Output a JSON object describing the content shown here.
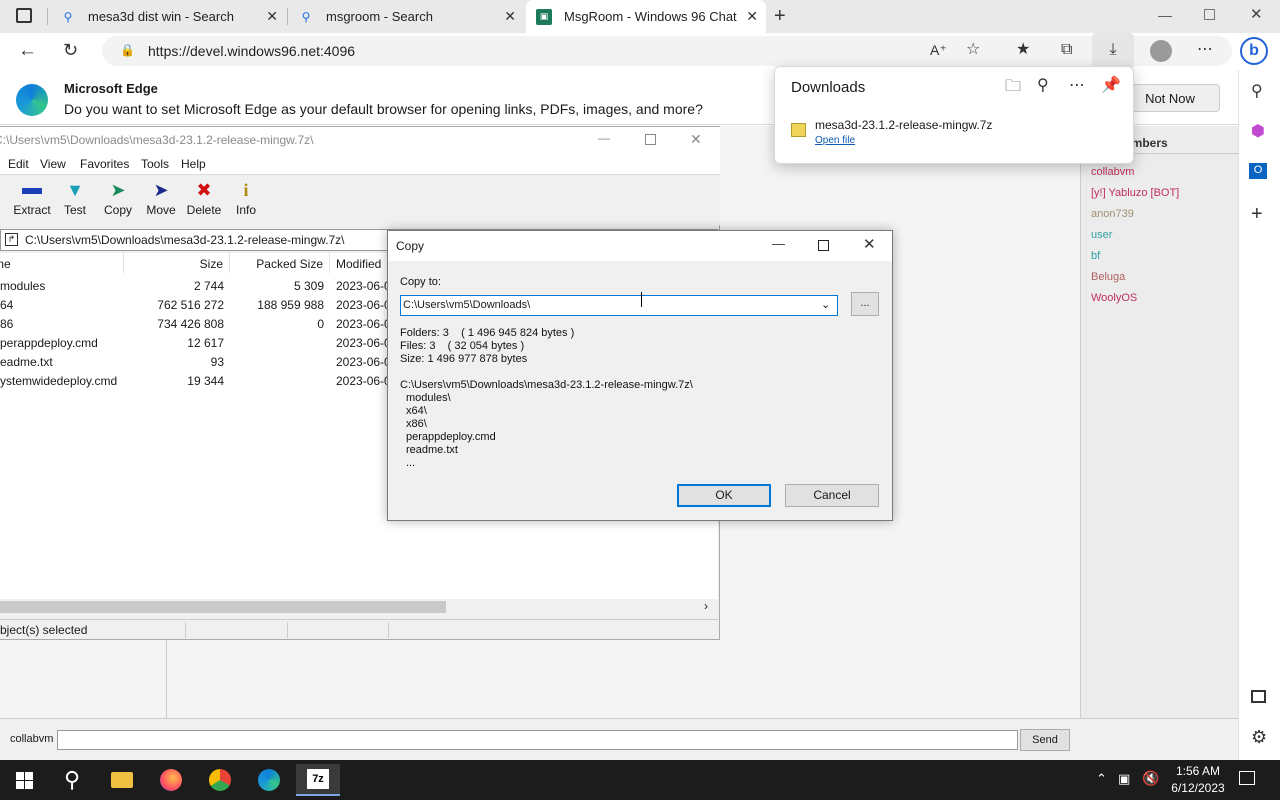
{
  "browser": {
    "tabs": [
      {
        "title": "mesa3d dist win - Search",
        "icon": "search-icon"
      },
      {
        "title": "msgroom - Search",
        "icon": "search-icon"
      },
      {
        "title": "MsgRoom - Windows 96 Chat",
        "icon": "chat-app-icon"
      }
    ],
    "url": "https://devel.windows96.net:4096",
    "infobar": {
      "title": "Microsoft Edge",
      "message": "Do you want to set Microsoft Edge as your default browser for opening links, PDFs, images, and more?",
      "not_now": "Not Now"
    }
  },
  "downloads": {
    "title": "Downloads",
    "file_name": "mesa3d-23.1.2-release-mingw.7z",
    "open_file": "Open file"
  },
  "chat": {
    "members_title": "Members",
    "members": [
      {
        "name": "collabvm",
        "color": "#c0305a"
      },
      {
        "name": "[y!] Yabluzo [BOT]",
        "color": "#c0305a"
      },
      {
        "name": "anon739",
        "color": "#a09070"
      },
      {
        "name": "user",
        "color": "#30a0a0"
      },
      {
        "name": "bf",
        "color": "#30a0a0"
      },
      {
        "name": "Beluga",
        "color": "#b06060"
      },
      {
        "name": "WoolyOS",
        "color": "#c0305a"
      }
    ],
    "username": "collabvm",
    "message_value": "",
    "send_label": "Send"
  },
  "sevenzip": {
    "title": "C:\\Users\\vm5\\Downloads\\mesa3d-23.1.2-release-mingw.7z\\",
    "menu": [
      "Edit",
      "View",
      "Favorites",
      "Tools",
      "Help"
    ],
    "tools": [
      {
        "label": "Extract",
        "icon": "extract-icon"
      },
      {
        "label": "Test",
        "icon": "test-icon"
      },
      {
        "label": "Copy",
        "icon": "copy-icon"
      },
      {
        "label": "Move",
        "icon": "move-icon"
      },
      {
        "label": "Delete",
        "icon": "delete-icon"
      },
      {
        "label": "Info",
        "icon": "info-icon"
      }
    ],
    "path": "C:\\Users\\vm5\\Downloads\\mesa3d-23.1.2-release-mingw.7z\\",
    "columns": [
      "me",
      "Size",
      "Packed Size",
      "Modified"
    ],
    "rows": [
      {
        "name": "modules",
        "size": "2 744",
        "packed": "5 309",
        "modified": "2023-06-0"
      },
      {
        "name": "64",
        "size": "762 516 272",
        "packed": "188 959 988",
        "modified": "2023-06-0"
      },
      {
        "name": "86",
        "size": "734 426 808",
        "packed": "0",
        "modified": "2023-06-0"
      },
      {
        "name": "perappdeploy.cmd",
        "size": "12 617",
        "packed": "",
        "modified": "2023-06-0"
      },
      {
        "name": "eadme.txt",
        "size": "93",
        "packed": "",
        "modified": "2023-06-0"
      },
      {
        "name": "ystemwidedeploy.cmd",
        "size": "19 344",
        "packed": "",
        "modified": "2023-06-0"
      }
    ],
    "status": "bject(s) selected"
  },
  "copy_dialog": {
    "title": "Copy",
    "copy_to_label": "Copy to:",
    "destination": "C:\\Users\\vm5\\Downloads\\",
    "browse_label": "...",
    "folders": "Folders: 3    ( 1 496 945 824 bytes )",
    "files": "Files: 3    ( 32 054 bytes )",
    "size": "Size: 1 496 977 878 bytes",
    "source_path": "C:\\Users\\vm5\\Downloads\\mesa3d-23.1.2-release-mingw.7z\\",
    "items": [
      "modules\\",
      "x64\\",
      "x86\\",
      "perappdeploy.cmd",
      "readme.txt",
      "..."
    ],
    "ok_label": "OK",
    "cancel_label": "Cancel"
  },
  "taskbar": {
    "time": "1:56 AM",
    "date": "6/12/2023"
  },
  "colors": {
    "accent": "#0078d7",
    "taskbar": "#1c1c1c",
    "delete_red": "#d01010"
  }
}
